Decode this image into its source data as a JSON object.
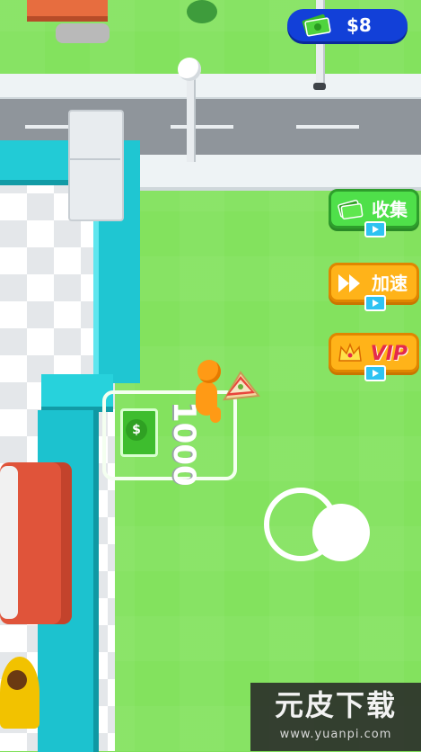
{
  "hud": {
    "money_value": "$8",
    "money_icon": "cash-stack-icon"
  },
  "side_buttons": [
    {
      "id": "collect",
      "label": "收集",
      "icon": "cash-icon",
      "badge_icon": "video-ad-icon",
      "color": "#4fe04a"
    },
    {
      "id": "speed",
      "label": "加速",
      "icon": "fast-forward-icon",
      "badge_icon": "video-ad-icon",
      "color": "#ffb319"
    },
    {
      "id": "vip",
      "label": "VIP",
      "icon": "crown-icon",
      "badge_icon": "video-ad-icon",
      "color": "#ffb319"
    }
  ],
  "money_pad": {
    "price": "1000",
    "sign": "$"
  },
  "watermark": {
    "title": "元皮下载",
    "url": "www.yuanpi.com"
  },
  "colors": {
    "grass": "#83e25e",
    "shop_wall": "#22cbd6",
    "money_pill": "#1240d8",
    "player": "#ff9a15"
  }
}
